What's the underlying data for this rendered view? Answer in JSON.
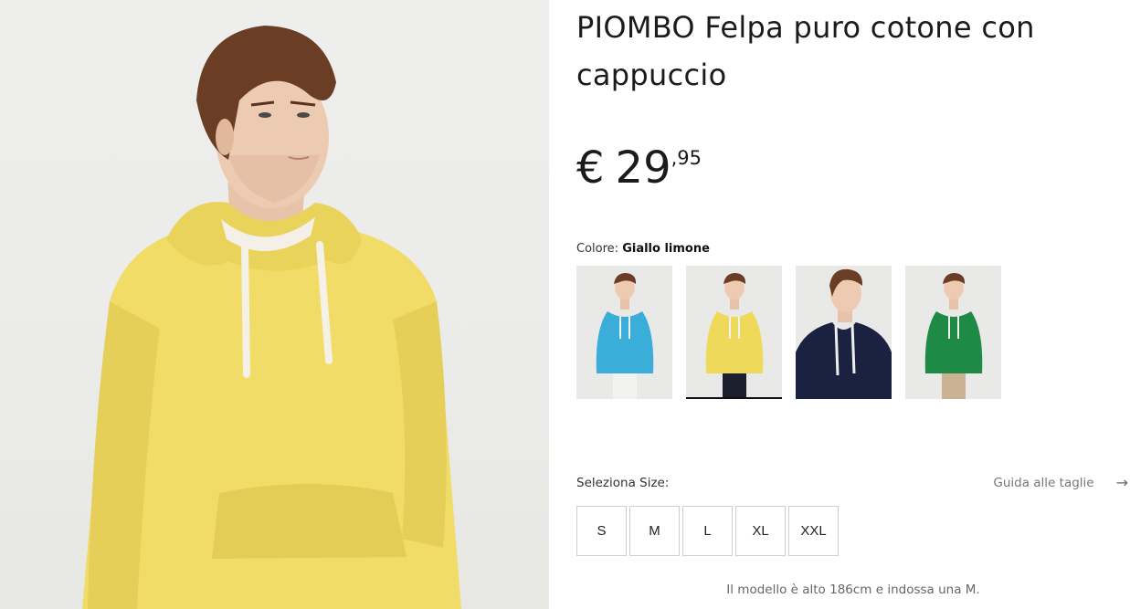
{
  "product": {
    "title": "PIOMBO Felpa puro cotone con cappuccio",
    "price": {
      "currency": "€",
      "integer": "29",
      "decimal": ",95"
    },
    "image_alt": "Felpa con cappuccio giallo limone indossata da modello"
  },
  "colors": {
    "label": "Colore:",
    "selected": "Giallo limone",
    "options": [
      {
        "name": "Azzurro",
        "hex": "#3aaed8",
        "pants": "#f2f2f0"
      },
      {
        "name": "Giallo limone",
        "hex": "#efd95a",
        "pants": "#1c1f2e"
      },
      {
        "name": "Blu navy",
        "hex": "#1b2140",
        "pants": "#1b2140"
      },
      {
        "name": "Verde",
        "hex": "#1f8a45",
        "pants": "#c9b394"
      }
    ]
  },
  "sizes": {
    "label": "Seleziona Size:",
    "guide_label": "Guida alle taglie",
    "guide_icon": "arrow-right-icon",
    "options": [
      "S",
      "M",
      "L",
      "XL",
      "XXL"
    ]
  },
  "model_note": "Il modello è alto 186cm e indossa una M."
}
